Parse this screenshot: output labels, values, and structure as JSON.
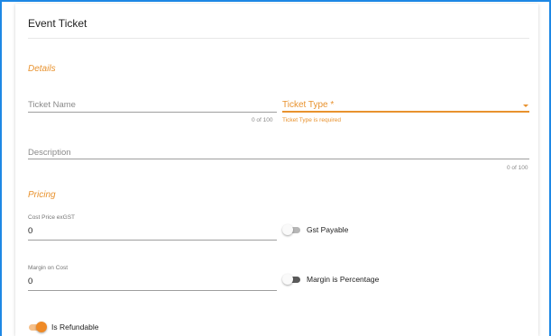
{
  "card": {
    "title": "Event Ticket"
  },
  "details": {
    "heading": "Details",
    "ticket_name": {
      "label": "Ticket Name",
      "value": "",
      "counter": "0 of 100"
    },
    "ticket_type": {
      "label": "Ticket Type *",
      "error": "Ticket Type is required"
    },
    "description": {
      "label": "Description",
      "value": "",
      "counter": "0 of 100"
    }
  },
  "pricing": {
    "heading": "Pricing",
    "cost_price": {
      "label": "Cost Price exGST",
      "value": "0"
    },
    "gst_payable": {
      "label": "Gst Payable",
      "checked": false
    },
    "margin_on_cost": {
      "label": "Margin on Cost",
      "value": "0"
    },
    "margin_is_percentage": {
      "label": "Margin is Percentage",
      "checked": false
    },
    "is_refundable": {
      "label": "Is Refundable",
      "checked": true
    }
  },
  "colors": {
    "accent": "#e8922e",
    "frame": "#1e88e5"
  }
}
